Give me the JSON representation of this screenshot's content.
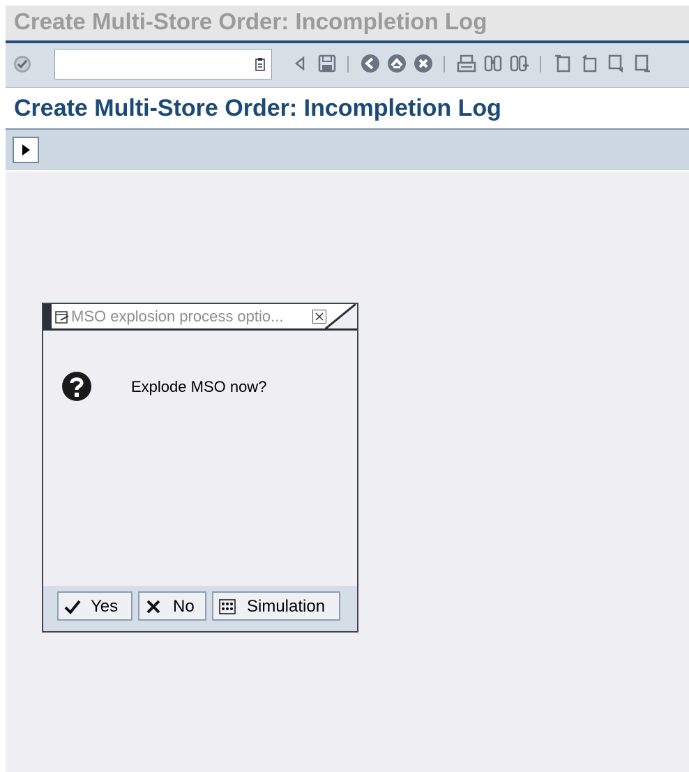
{
  "window": {
    "title": "Create Multi-Store Order: Incompletion Log"
  },
  "toolbar": {
    "command_field_value": "",
    "icons": [
      "enter-icon",
      "command-history-icon",
      "back-arrow-icon",
      "save-icon",
      "back-icon",
      "exit-icon",
      "cancel-icon",
      "print-icon",
      "find-icon",
      "find-next-icon",
      "first-page-icon",
      "previous-page-icon",
      "next-page-icon",
      "last-page-icon"
    ]
  },
  "app": {
    "title": "Create Multi-Store Order: Incompletion Log",
    "expand_button_icon": "play-arrow-icon"
  },
  "dialog": {
    "title": "MSO explosion process optio...",
    "message": "Explode MSO now?",
    "buttons": {
      "yes": "Yes",
      "no": "No",
      "simulation": "Simulation"
    }
  }
}
